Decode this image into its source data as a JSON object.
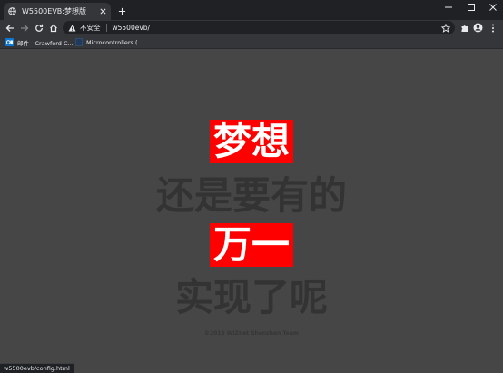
{
  "browser": {
    "tab": {
      "title": "W5500EVB:梦想版",
      "favicon": "globe-icon"
    },
    "address_bar": {
      "security_label": "不安全",
      "url": "w5500evb/"
    },
    "bookmarks": [
      {
        "label": "邮件 - Crawford C...",
        "icon": "outlook-icon"
      },
      {
        "label": "Microcontrollers (...",
        "icon": "page-icon"
      }
    ],
    "status_url": "w5500evb/config.html"
  },
  "page": {
    "line1": "梦想",
    "line2": "还是要有的",
    "line3": "万一",
    "line4": "实现了呢",
    "copyright": "©2016 WIZnet Shenzhen Team"
  },
  "colors": {
    "highlight": "#ff0000",
    "page_background": "#464646",
    "text_dark": "#333333"
  }
}
